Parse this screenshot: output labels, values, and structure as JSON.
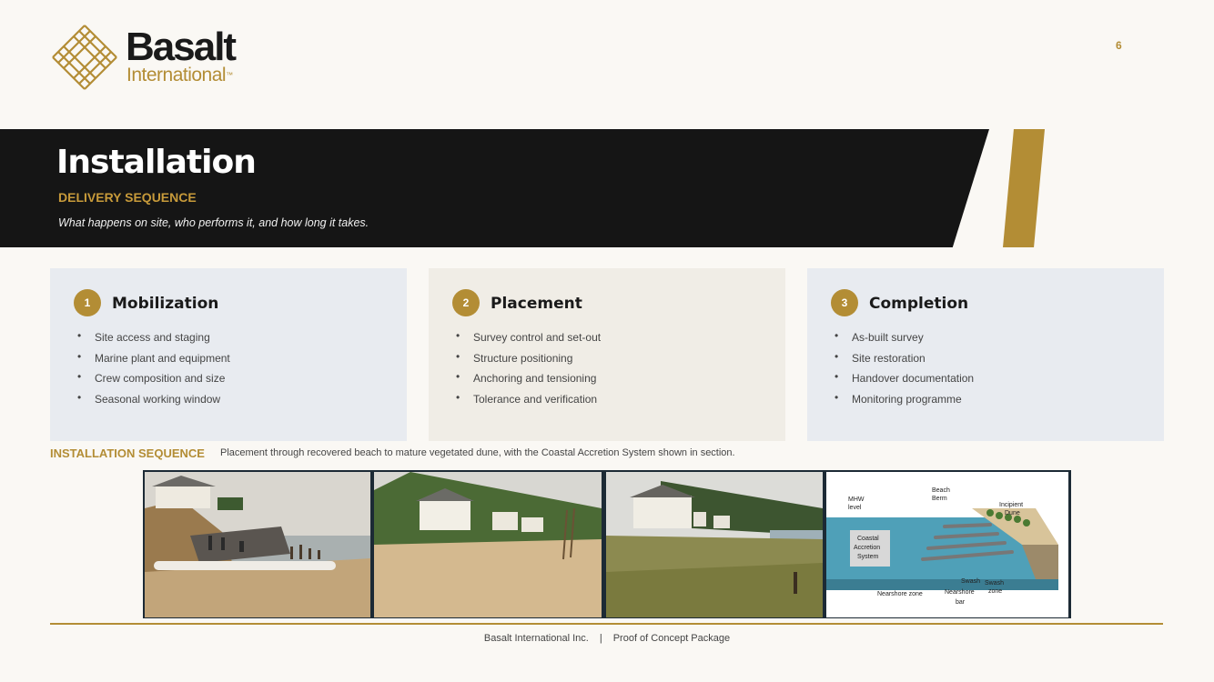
{
  "logo": {
    "word": "Basalt",
    "sub": "International",
    "tm": "™",
    "mark_icon": "woven-lattice-icon"
  },
  "page_number": "6",
  "header": {
    "title": "Installation",
    "subtitle": "DELIVERY SEQUENCE",
    "tagline": "What happens on site, who performs it, and how long it takes."
  },
  "steps": [
    {
      "num": "1",
      "title": "Mobilization",
      "items": [
        "Site access and staging",
        "Marine plant and equipment",
        "Crew composition and size",
        "Seasonal working window"
      ]
    },
    {
      "num": "2",
      "title": "Placement",
      "items": [
        "Survey control and set-out",
        "Structure positioning",
        "Anchoring and tensioning",
        "Tolerance and verification"
      ]
    },
    {
      "num": "3",
      "title": "Completion",
      "items": [
        "As-built survey",
        "Site restoration",
        "Handover documentation",
        "Monitoring programme"
      ]
    }
  ],
  "sequence": {
    "label": "INSTALLATION SEQUENCE",
    "description": "Placement through recovered beach to mature vegetated dune, with the Coastal Accretion System shown in section."
  },
  "diagram": {
    "beach_berm": [
      "Beach",
      "Berm"
    ],
    "mhw_level": [
      "MHW",
      "level"
    ],
    "incipient_dune": [
      "Incipient",
      "Dune"
    ],
    "coastal_accretion_system": [
      "Coastal",
      "Accretion",
      "System"
    ],
    "swash": "Swash",
    "swash_zone": [
      "Swash",
      "zone"
    ],
    "nearshore_zone": "Nearshore zone",
    "nearshore_bar": [
      "Nearshore",
      "bar"
    ]
  },
  "footer": {
    "company": "Basalt International Inc.",
    "separator": "|",
    "doc": "Proof of Concept Package"
  },
  "colors": {
    "gold": "#b38d35",
    "dark": "#151515",
    "card_blue": "#e8ebf0",
    "card_beige": "#f0ede6"
  }
}
